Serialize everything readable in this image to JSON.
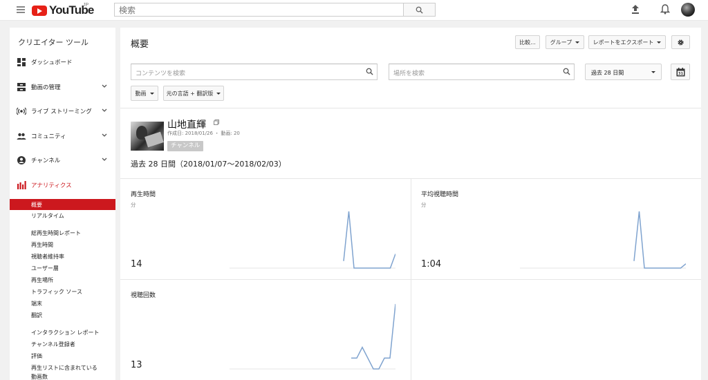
{
  "topbar": {
    "logo_text": "YouTube",
    "logo_region": "JP",
    "search_placeholder": "検索"
  },
  "sidebar": {
    "title": "クリエイター ツール",
    "items": [
      {
        "label": "ダッシュボード",
        "icon": "dashboard-icon"
      },
      {
        "label": "動画の管理",
        "icon": "video-manager-icon"
      },
      {
        "label": "ライブ ストリーミング",
        "icon": "live-icon"
      },
      {
        "label": "コミュニティ",
        "icon": "community-icon"
      },
      {
        "label": "チャンネル",
        "icon": "channel-icon"
      },
      {
        "label": "アナリティクス",
        "icon": "analytics-icon"
      }
    ],
    "analytics_sub": [
      "概要",
      "リアルタイム"
    ],
    "watch_reports_header": "総再生時間レポート",
    "watch_reports": [
      "再生時間",
      "視聴者維持率",
      "ユーザー層",
      "再生場所",
      "トラフィック ソース",
      "端末",
      "翻訳"
    ],
    "interaction_reports_header": "インタラクション レポート",
    "interaction_reports": [
      "チャンネル登録者",
      "評価",
      "再生リストに含まれている",
      "動画数"
    ]
  },
  "accent_color": "#cc181e",
  "main": {
    "title": "概要",
    "buttons": {
      "compare": "比較...",
      "group": "グループ",
      "export": "レポートをエクスポート"
    },
    "content_search_placeholder": "コンテンツを検索",
    "location_search_placeholder": "場所を検索",
    "date_range": "過去 28 日間",
    "calendar_day": "31",
    "filter_video": "動画",
    "filter_language": "元の言語 + 翻訳版",
    "channel": {
      "name": "山地直輝",
      "meta": "作成日: 2018/01/26 ・ 動画: 20",
      "badge": "チャンネル"
    },
    "period_label": "過去 28 日間（2018/01/07〜2018/02/03）",
    "metrics": [
      {
        "title": "再生時間",
        "unit": "分",
        "value": "14"
      },
      {
        "title": "平均視聴時間",
        "unit": "分",
        "value": "1:04"
      },
      {
        "title": "視聴回数",
        "unit": "",
        "value": "13"
      }
    ]
  },
  "chart_data": [
    {
      "type": "line",
      "name": "再生時間",
      "values": [
        0,
        0,
        0,
        0,
        0,
        0,
        0,
        0,
        0,
        0,
        0,
        0,
        0,
        0,
        0,
        0,
        0,
        0,
        0,
        0,
        0,
        0,
        1,
        8,
        0,
        0,
        0,
        0,
        0,
        0,
        0,
        0,
        2
      ]
    },
    {
      "type": "line",
      "name": "平均視聴時間",
      "values": [
        0,
        0,
        0,
        0,
        0,
        0,
        0,
        0,
        0,
        0,
        0,
        0,
        0,
        0,
        0,
        0,
        0,
        0,
        0,
        0,
        0,
        0,
        1,
        8,
        0,
        0,
        0,
        0,
        0,
        0,
        0,
        0,
        0.6
      ]
    },
    {
      "type": "line",
      "name": "視聴回数",
      "values": [
        0,
        0,
        0,
        0,
        0,
        0,
        0,
        0,
        0,
        0,
        0,
        0,
        0,
        0,
        0,
        0,
        0,
        0,
        0,
        0,
        0,
        0,
        1,
        1,
        2,
        1,
        0,
        0,
        1,
        1,
        6
      ]
    }
  ]
}
